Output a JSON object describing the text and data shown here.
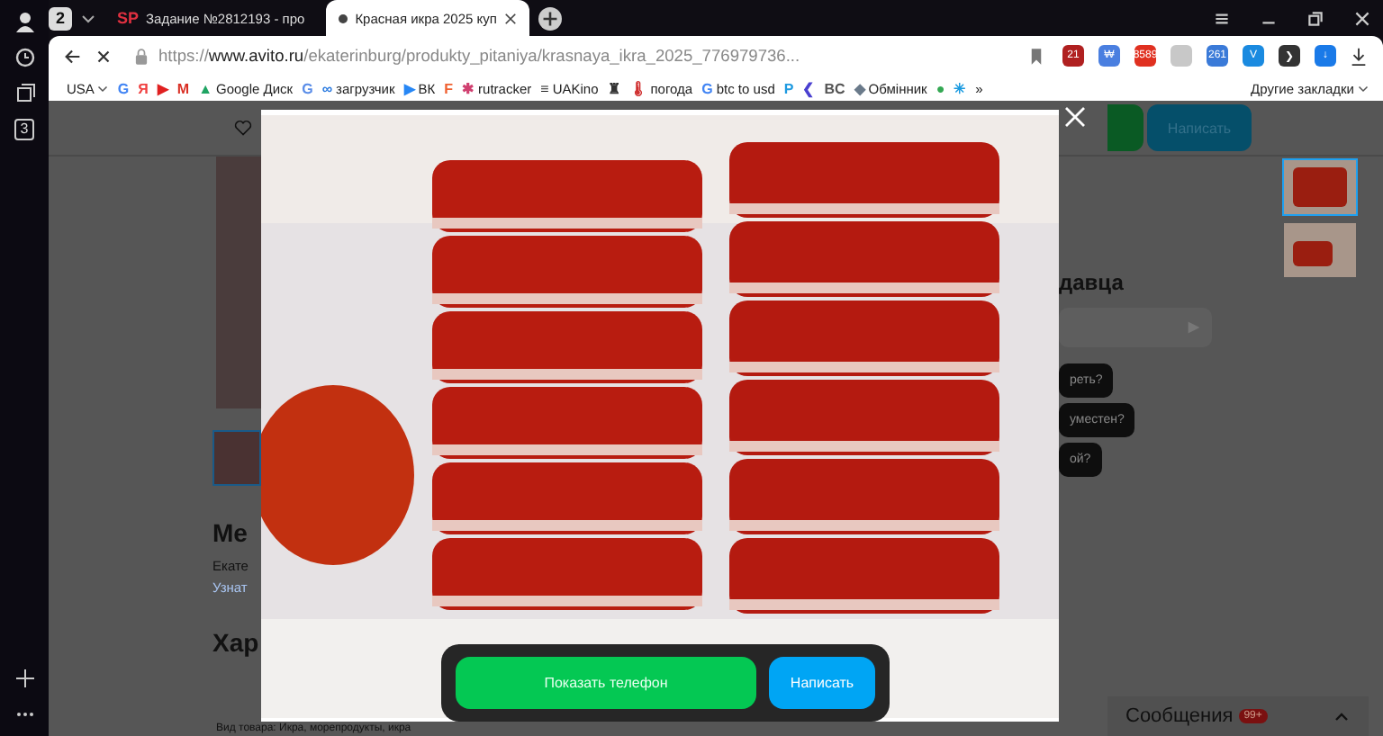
{
  "sidebar": {
    "badge": "3"
  },
  "tab_strip": {
    "count": "2",
    "tabs": [
      {
        "favicon": "SP",
        "title": "Задание №2812193 - про",
        "selected": false
      },
      {
        "title": "Красная икра 2025 куп",
        "selected": true
      }
    ]
  },
  "address_bar": {
    "scheme": "https://",
    "host": "www.avito.ru",
    "path": "/ekaterinburg/produkty_pitaniya/krasnaya_ikra_2025_776979736..."
  },
  "extensions": [
    {
      "glyph": "21",
      "color": "#b02020"
    },
    {
      "glyph": "₩",
      "color": "#4a7fe0"
    },
    {
      "glyph": "8589",
      "color": "#e03020"
    },
    {
      "color": "#c8c8c8"
    },
    {
      "glyph": "261",
      "color": "#3a7ad8"
    },
    {
      "glyph": "V",
      "color": "#1a8ae0"
    },
    {
      "glyph": "❯",
      "color": "#333333"
    },
    {
      "glyph": "↓",
      "color": "#1a7ae8"
    }
  ],
  "bookmarks": [
    {
      "kind": "dropdown",
      "label": "USA"
    },
    {
      "kind": "icon",
      "glyph": "G",
      "color": "#4285f4"
    },
    {
      "kind": "icon",
      "glyph": "Я",
      "color": "#f04040"
    },
    {
      "kind": "icon",
      "glyph": "▶",
      "color": "#e02020"
    },
    {
      "kind": "icon",
      "glyph": "M",
      "color": "#d93025"
    },
    {
      "kind": "link",
      "glyph": "▲",
      "color": "#1fa463",
      "label": "Google Диск"
    },
    {
      "kind": "icon",
      "glyph": "G",
      "color": "#5a8de8"
    },
    {
      "kind": "link",
      "glyph": "∞",
      "color": "#2a7ae0",
      "label": "загрузчик"
    },
    {
      "kind": "link",
      "glyph": "▶",
      "color": "#2787f5",
      "label": "ВК"
    },
    {
      "kind": "icon",
      "glyph": "F",
      "color": "#f06030"
    },
    {
      "kind": "link",
      "glyph": "✱",
      "color": "#d04070",
      "label": "rutracker"
    },
    {
      "kind": "link",
      "glyph": "≡",
      "color": "#222222",
      "label": "UAKino"
    },
    {
      "kind": "icon",
      "glyph": "♜",
      "color": "#333333"
    },
    {
      "kind": "link",
      "glyph": "🌡",
      "color": "#d03030",
      "label": "погода"
    },
    {
      "kind": "link",
      "glyph": "G",
      "color": "#4285f4",
      "label": "btc to usd"
    },
    {
      "kind": "icon",
      "glyph": "P",
      "color": "#1e9ae0"
    },
    {
      "kind": "icon",
      "glyph": "❮",
      "color": "#4a40d0"
    },
    {
      "kind": "icon",
      "glyph": "BC",
      "color": "#555555"
    },
    {
      "kind": "link",
      "glyph": "◆",
      "color": "#6a7a8a",
      "label": "Обмінник"
    },
    {
      "kind": "icon",
      "glyph": "●",
      "color": "#34a853"
    },
    {
      "kind": "icon",
      "glyph": "✳",
      "color": "#1a9ae0"
    },
    {
      "kind": "more",
      "label": "»"
    },
    {
      "kind": "dropdown",
      "label": "Другие закладки"
    }
  ],
  "page": {
    "write_button": "Написать",
    "left_texts": [
      {
        "kind": "heading",
        "text": "Ме"
      },
      {
        "kind": "text",
        "text": "Екате"
      },
      {
        "kind": "link",
        "text": "Узнат"
      },
      {
        "kind": "heading",
        "text": "Хар"
      }
    ],
    "bottom_text": "Вид товара: Икра, морепродукты, икра",
    "seller_heading": "давца",
    "chips": [
      "реть?",
      "уместен?",
      "ой?"
    ],
    "thumbnails": [
      {
        "selected": true
      },
      {
        "selected": false
      }
    ],
    "messages": {
      "label": "Сообщения",
      "badge": "99+"
    }
  },
  "gallery": {
    "phone_button": "Показать телефон",
    "write_button": "Написать"
  }
}
